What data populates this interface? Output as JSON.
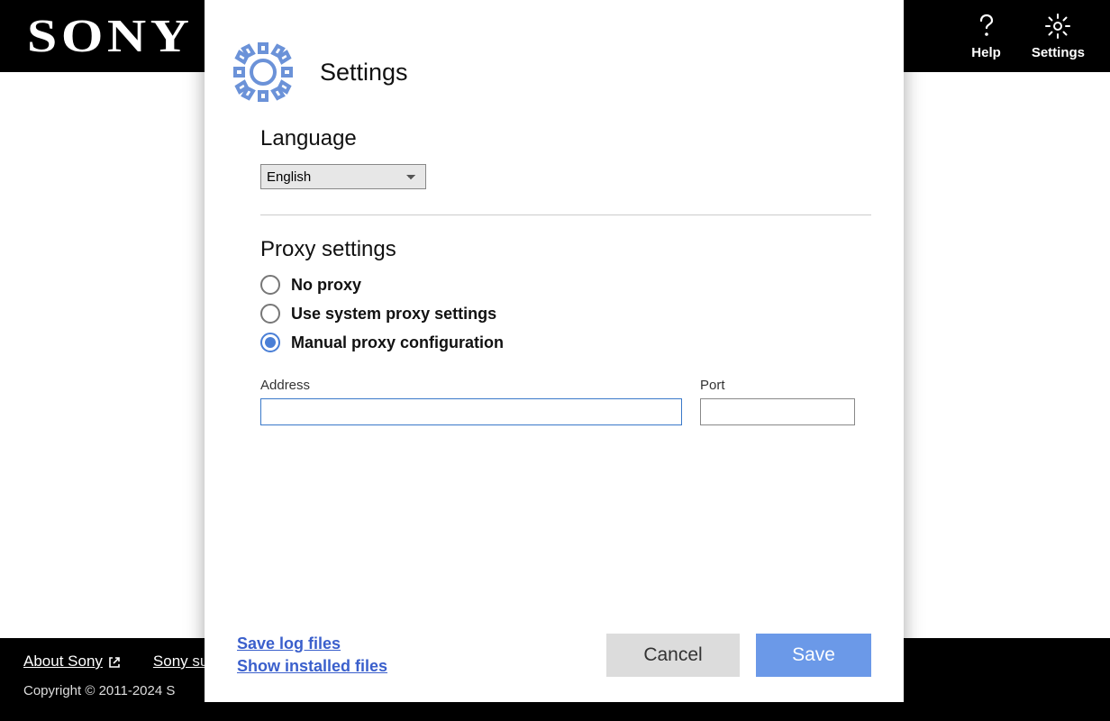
{
  "header": {
    "brand_text": "SONY",
    "nav": {
      "help_label": "Help",
      "settings_label": "Settings"
    }
  },
  "footer": {
    "about_label": "About Sony",
    "support_label": "Sony su",
    "copyright_text": "Copyright © 2011-2024 S"
  },
  "dialog": {
    "title": "Settings",
    "language_section_label": "Language",
    "language_selected": "English",
    "proxy_section_label": "Proxy settings",
    "proxy_options": {
      "no_proxy": "No proxy",
      "system_proxy": "Use system proxy settings",
      "manual_proxy": "Manual proxy configuration"
    },
    "proxy_selected_index": 2,
    "address_label": "Address",
    "address_value": "",
    "port_label": "Port",
    "port_value": "",
    "links": {
      "save_logs": "Save log files",
      "show_installed": "Show installed files"
    },
    "buttons": {
      "cancel": "Cancel",
      "save": "Save"
    }
  }
}
